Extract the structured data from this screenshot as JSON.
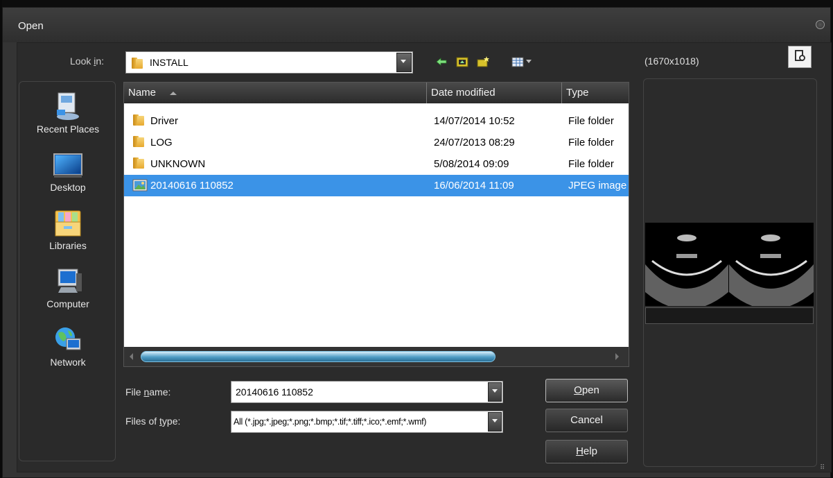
{
  "window": {
    "title": "Open"
  },
  "look_in": {
    "label": "Look in:",
    "mnemonic": "i",
    "value": "INSTALL"
  },
  "toolbar": {
    "icons": [
      "back-arrow-icon",
      "up-folder-icon",
      "new-folder-icon",
      "view-menu-icon"
    ]
  },
  "preview": {
    "dimensions": "(1670x1018)"
  },
  "places": [
    {
      "label": "Recent Places",
      "icon": "recent-places-icon"
    },
    {
      "label": "Desktop",
      "icon": "desktop-icon"
    },
    {
      "label": "Libraries",
      "icon": "libraries-icon"
    },
    {
      "label": "Computer",
      "icon": "computer-icon"
    },
    {
      "label": "Network",
      "icon": "network-icon"
    }
  ],
  "file_list": {
    "columns": [
      "Name",
      "Date modified",
      "Type"
    ],
    "rows": [
      {
        "name": "Driver",
        "date": "14/07/2014 10:52",
        "type": "File folder",
        "icon": "folder-icon",
        "selected": false
      },
      {
        "name": "LOG",
        "date": "24/07/2013 08:29",
        "type": "File folder",
        "icon": "folder-icon",
        "selected": false
      },
      {
        "name": "UNKNOWN",
        "date": "5/08/2014 09:09",
        "type": "File folder",
        "icon": "folder-icon",
        "selected": false
      },
      {
        "name": "20140616 110852",
        "date": "16/06/2014 11:09",
        "type": "JPEG image",
        "icon": "jpeg-file-icon",
        "selected": true
      }
    ]
  },
  "file_name": {
    "label_pre": "File ",
    "label_mn": "n",
    "label_post": "ame:",
    "value": "20140616 110852"
  },
  "files_of_type": {
    "label_pre": "Files of ",
    "label_mn": "t",
    "label_post": "ype:",
    "value": "All (*.jpg;*.jpeg;*.png;*.bmp;*.tif;*.tiff;*.ico;*.emf;*.wmf)"
  },
  "buttons": {
    "open": {
      "mn": "O",
      "rest": "pen"
    },
    "cancel": "Cancel",
    "help": {
      "mn": "H",
      "rest": "elp"
    }
  },
  "colors": {
    "selection": "#3b93e7",
    "window_bg": "#343434",
    "client_bg": "#2b2b2b"
  }
}
